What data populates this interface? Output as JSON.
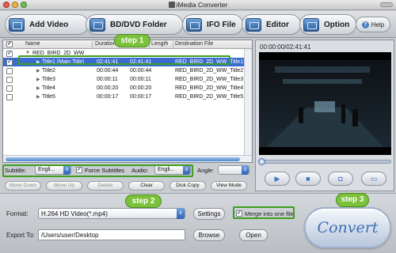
{
  "window": {
    "title": "iMedia Converter"
  },
  "toolbar": {
    "add_video": "Add Video",
    "bd_dvd_folder": "BD/DVD Folder",
    "ifo_file": "IFO File",
    "editor": "Editor",
    "option": "Option",
    "help": "Help"
  },
  "file_list": {
    "columns": {
      "name": "Name",
      "duration": "Duration",
      "length": "Length",
      "destination": "Destination File"
    },
    "group": "RED_BIRD_2D_WW",
    "rows": [
      {
        "name": "Title1 (Main Title)",
        "duration": "02:41:41",
        "length": "02:41:41",
        "destination": "RED_BIRD_2D_WW_Title1",
        "checked": true,
        "selected": true
      },
      {
        "name": "Title2",
        "duration": "00:00:44",
        "length": "00:00:44",
        "destination": "RED_BIRD_2D_WW_Title2",
        "checked": false,
        "selected": false
      },
      {
        "name": "Title3",
        "duration": "00:00:11",
        "length": "00:00:11",
        "destination": "RED_BIRD_2D_WW_Title3",
        "checked": false,
        "selected": false
      },
      {
        "name": "Title4",
        "duration": "00:00:20",
        "length": "00:00:20",
        "destination": "RED_BIRD_2D_WW_Title4",
        "checked": false,
        "selected": false
      },
      {
        "name": "Title5",
        "duration": "00:00:17",
        "length": "00:00:17",
        "destination": "RED_BIRD_2D_WW_Title5",
        "checked": false,
        "selected": false
      }
    ]
  },
  "options": {
    "subtitle_label": "Subtitle:",
    "subtitle_value": "Engli...",
    "force_subtitles": "Force Subtitles",
    "audio_label": "Audio:",
    "audio_value": "Engli...",
    "angle_label": "Angle:",
    "angle_value": ""
  },
  "actions": {
    "move_down": "Move Down",
    "move_up": "Move Up",
    "delete": "Delete",
    "clear": "Clear",
    "disk_copy": "Disk Copy",
    "view_mode": "View Mode"
  },
  "preview": {
    "time": "00:00:00/02:41:41"
  },
  "bottom": {
    "format_label": "Format:",
    "format_value": "H.264 HD Video(*.mp4)",
    "settings": "Settings",
    "merge": "Merge into one file",
    "export_label": "Export To:",
    "export_path": "/Users/user/Desktop",
    "browse": "Browse",
    "open": "Open",
    "convert": "Convert"
  },
  "steps": {
    "step1": "step 1",
    "step2": "step 2",
    "step3": "step 3"
  },
  "colors": {
    "accent": "#3a6bd1",
    "step_green": "#7cc13b",
    "convert_text": "#3f6fb4"
  }
}
